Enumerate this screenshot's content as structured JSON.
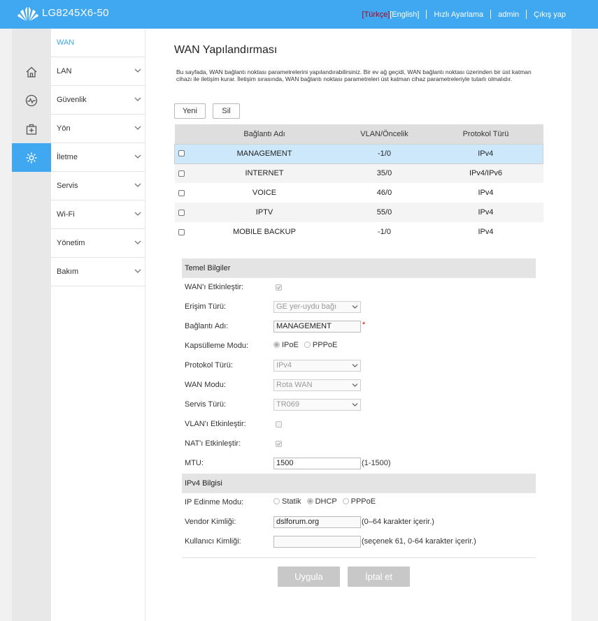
{
  "header": {
    "model": "LG8245X6-50",
    "lang_turkish": "[Türkçe]",
    "lang_english": "[English]",
    "quick_setup": "Hızlı Ayarlama",
    "user": "admin",
    "logout": "Çıkış yap"
  },
  "colors": {
    "accent": "#3fa8f1",
    "selected_row": "#cde8fb",
    "active_lang": "#b3001b"
  },
  "iconbar": {
    "icons": [
      "home-icon",
      "status-icon",
      "network-icon",
      "settings-icon"
    ],
    "active": "settings-icon"
  },
  "sidebar": {
    "items": [
      {
        "label": "WAN",
        "current": true
      },
      {
        "label": "LAN"
      },
      {
        "label": "Güvenlik"
      },
      {
        "label": "Yön"
      },
      {
        "label": "İletme"
      },
      {
        "label": "Servis"
      },
      {
        "label": "Wi-Fi"
      },
      {
        "label": "Yönetim"
      },
      {
        "label": "Bakım"
      }
    ]
  },
  "main": {
    "title": "WAN Yapılandırması",
    "description": "Bu sayfada, WAN bağlantı noktası parametrelerini yapılandırabilirsiniz. Bir ev ağ geçidi, WAN bağlantı noktası üzerinden bir üst katman cihazı ile iletişim kurar. İletişim sırasında, WAN bağlantı noktası parametreleri üst katman cihaz parametreleriyle tutarlı olmalıdır.",
    "new_button": "Yeni",
    "delete_button": "Sil"
  },
  "wan_table": {
    "headers": [
      "Bağlantı Adı",
      "VLAN/Öncelik",
      "Protokol Türü"
    ],
    "rows": [
      {
        "name": "MANAGEMENT",
        "vlan": "-1/0",
        "protocol": "IPv4"
      },
      {
        "name": "INTERNET",
        "vlan": "35/0",
        "protocol": "IPv4/IPv6"
      },
      {
        "name": "VOICE",
        "vlan": "46/0",
        "protocol": "IPv4"
      },
      {
        "name": "IPTV",
        "vlan": "55/0",
        "protocol": "IPv4"
      },
      {
        "name": "MOBILE BACKUP",
        "vlan": "-1/0",
        "protocol": "IPv4"
      }
    ]
  },
  "basic": {
    "section_title": "Temel Bilgiler",
    "enable_wan_label": "WAN'ı Etkinleştir:",
    "access_type_label": "Erişim Türü:",
    "access_type_value": "GE yer-uydu bağı",
    "conn_name_label": "Bağlantı Adı:",
    "conn_name_value": "MANAGEMENT",
    "required_mark": "*",
    "encap_label": "Kapsülleme Modu:",
    "encap_ipoe": "IPoE",
    "encap_pppoe": "PPPoE",
    "protocol_label": "Protokol Türü:",
    "protocol_value": "IPv4",
    "wan_mode_label": "WAN Modu:",
    "wan_mode_value": "Rota WAN",
    "service_label": "Servis Türü:",
    "service_value": "TR069",
    "vlan_label": "VLAN'ı Etkinleştir:",
    "nat_label": "NAT'ı Etkinleştir:",
    "mtu_label": "MTU:",
    "mtu_value": "1500",
    "mtu_hint": "(1-1500)"
  },
  "ipv4": {
    "section_title": "IPv4 Bilgisi",
    "ip_mode_label": "IP Edinme Modu:",
    "ip_static": "Statik",
    "ip_dhcp": "DHCP",
    "ip_pppoe": "PPPoE",
    "vendor_label": "Vendor Kimliği:",
    "vendor_value": "dslforum.org",
    "vendor_hint": "(0–64 karakter içerir.)",
    "user_id_label": "Kullanıcı Kimliği:",
    "user_id_value": "",
    "user_id_hint": "(seçenek 61, 0-64 karakter içerir.)"
  },
  "actions": {
    "apply": "Uygula",
    "cancel": "İptal et"
  }
}
